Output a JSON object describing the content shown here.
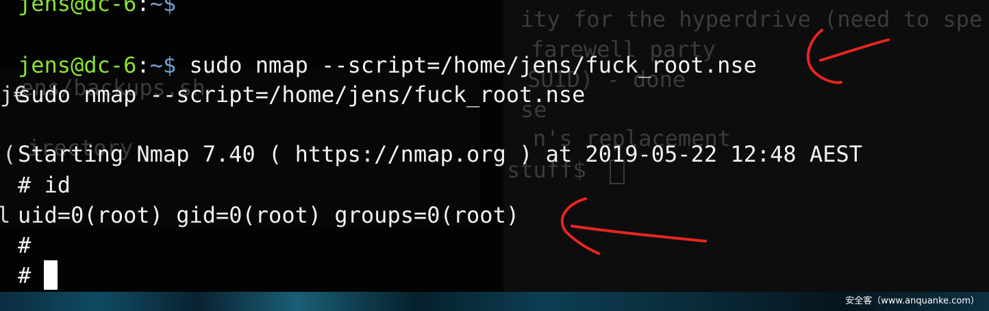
{
  "terminal": {
    "prompt": {
      "user_host": "jens@dc-6",
      "separator": ":",
      "path": "~$"
    },
    "lines": {
      "top_partial_prompt": "",
      "command": " sudo nmap --script=/home/jens/fuck_root.nse",
      "echo": "sudo nmap --script=/home/jens/fuck_root.nse",
      "nmap_start": "Starting Nmap 7.40 ( https://nmap.org ) at 2019-05-22 12:48 AEST",
      "id_cmd": "# id",
      "id_output": "uid=0(root) gid=0(root) groups=0(root)",
      "root_prompt_1": "#",
      "root_prompt_2": "#"
    },
    "background_text": [
      "ity for the hyperdrive (need to spe",
      "farewell party",
      "SUID) - done",
      "ens/backups.sh",
      "se",
      "n's replacement",
      "irectory",
      "stuff$"
    ],
    "edge_glyphs": [
      "j€",
      "(",
      "l"
    ]
  },
  "annotations": {
    "arrow_color": "#e8261f"
  },
  "watermark": "安全客（www.anquanke.com）"
}
